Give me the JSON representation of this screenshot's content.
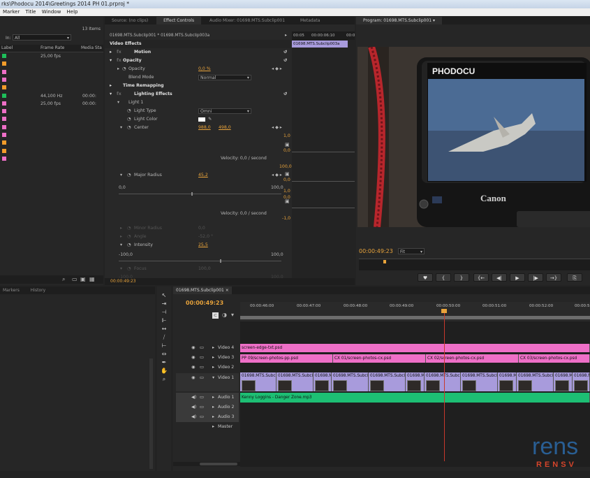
{
  "window": {
    "title": "rks\\Phodocu 2014\\Greetings 2014 PH 01.prproj *"
  },
  "menu": [
    "Marker",
    "Title",
    "Window",
    "Help"
  ],
  "project_panel": {
    "item_count": "13 Items",
    "in_label": "In:",
    "in_value": "All",
    "columns": [
      "Label",
      "Frame Rate",
      "Media Sta"
    ],
    "rows": [
      {
        "color": "#1dbf5a",
        "frame_rate": "25,00 fps",
        "media": ""
      },
      {
        "color": "#f39c2a",
        "frame_rate": "",
        "media": ""
      },
      {
        "color": "#ee6fc7",
        "frame_rate": "",
        "media": ""
      },
      {
        "color": "#ee6fc7",
        "frame_rate": "",
        "media": ""
      },
      {
        "color": "#f39c2a",
        "frame_rate": "",
        "media": ""
      },
      {
        "color": "#1dbf5a",
        "frame_rate": "44,100 Hz",
        "media": "00:00:"
      },
      {
        "color": "#ee6fc7",
        "frame_rate": "25,00 fps",
        "media": "00:00:"
      },
      {
        "color": "#ee6fc7",
        "frame_rate": "",
        "media": ""
      },
      {
        "color": "#ee6fc7",
        "frame_rate": "",
        "media": ""
      },
      {
        "color": "#ee6fc7",
        "frame_rate": "",
        "media": ""
      },
      {
        "color": "#ee6fc7",
        "frame_rate": "",
        "media": ""
      },
      {
        "color": "#f39c2a",
        "frame_rate": "",
        "media": ""
      },
      {
        "color": "#f39c2a",
        "frame_rate": "",
        "media": ""
      },
      {
        "color": "#ee6fc7",
        "frame_rate": "",
        "media": ""
      }
    ]
  },
  "effect_tabs": [
    "Source: (no clips)",
    "Effect Controls",
    "Audio Mixer: 01698.MTS.Subclip001",
    "Metadata"
  ],
  "effect_controls": {
    "clip_path": "01698.MTS.Subclip001 * 01698.MTS.Subclip003a",
    "mini_time_left": "00:05",
    "mini_time_right": "00:00:06:10",
    "mini_time_far": "00:0",
    "mini_clip": "01698.MTS.Subclip003a",
    "section": "Video Effects",
    "motion": "Motion",
    "opacity": "Opacity",
    "opacity_label": "Opacity",
    "opacity_value": "0,0 %",
    "blend_label": "Blend Mode",
    "blend_value": "Normal",
    "time_remap": "Time Remapping",
    "lighting": "Lighting Effects",
    "light1": "Light 1",
    "light_type_label": "Light Type",
    "light_type_value": "Omni",
    "light_color_label": "Light Color",
    "center_label": "Center",
    "center_x": "988,0",
    "center_y": "498,0",
    "graph1_top": "1,0",
    "graph1_mid": "0,0",
    "velocity1": "Velocity: 0,0 / second",
    "major_radius_label": "Major Radius",
    "major_radius_value": "45,2",
    "major_min": "0,0",
    "major_max": "100,0",
    "graph2_top": "100,0",
    "graph2_mid": "0,0",
    "graph2_b": "1,0",
    "graph2_c": "0,0",
    "velocity2": "Velocity: 0,0 / second",
    "graph2_neg": "-1,0",
    "minor_label": "Minor Radius",
    "minor_value": "0,0",
    "angle_label": "Angle",
    "angle_value": "-52,0 °",
    "intensity_label": "Intensity",
    "intensity_value": "25,5",
    "int_min": "-100,0",
    "int_max": "100,0",
    "focus_label": "Focus",
    "focus_value": "100,0",
    "focus_min": "-100,0",
    "focus_max": "100,0",
    "light2": "Light 2",
    "footer_time": "00:00:49:23"
  },
  "program": {
    "tab_label": "Program: 01698.MTS.Subclip001",
    "screen_brand": "PHODOCU",
    "camera_brand": "Canon",
    "timecode": "00:00:49:23",
    "fit_label": "Fit",
    "transport": [
      "♥",
      "{",
      "}",
      "{←",
      "◀|",
      "▶",
      "|▶",
      "→}",
      "⎘"
    ]
  },
  "markers_tabs": [
    "Markers",
    "History"
  ],
  "timeline": {
    "tab_label": "01698.MTS.Subclip001",
    "timecode": "00:00:49:23",
    "ruler": [
      "00:00:46:00",
      "00:00:47:00",
      "00:00:48:00",
      "00:00:49:00",
      "00:00:50:00",
      "00:00:51:00",
      "00:00:52:00",
      "00:00:5"
    ],
    "tracks": [
      {
        "name": "Video 4",
        "kind": "video"
      },
      {
        "name": "Video 3",
        "kind": "video"
      },
      {
        "name": "Video 2",
        "kind": "video"
      },
      {
        "name": "Video 1",
        "kind": "video"
      },
      {
        "name": "Audio 1",
        "kind": "audio"
      },
      {
        "name": "Audio 2",
        "kind": "audio"
      },
      {
        "name": "Audio 3",
        "kind": "audio"
      },
      {
        "name": "Master",
        "kind": "master"
      }
    ],
    "v4_clip": "screen-edge-txt.psd",
    "v3_clips": [
      "PP 09/screen-photos-pp.psd",
      "CX 01/screen-photos-cx.psd",
      "CX 02/screen-photos-cx.psd",
      "CX 03/screen-photos-cx.psd"
    ],
    "v1_clip": "01698.MTS.Subcl",
    "v1_clip_alt": "01698.M",
    "a1_clip": "Kenny Loggins - Danger Zone.mp3",
    "watermark": "rens",
    "watermark_sub": "RENSV"
  },
  "colors": {
    "accent": "#e8a33b",
    "pink": "#ee6fc7",
    "green": "#1dbf5a",
    "playhead": "#c8382c"
  }
}
